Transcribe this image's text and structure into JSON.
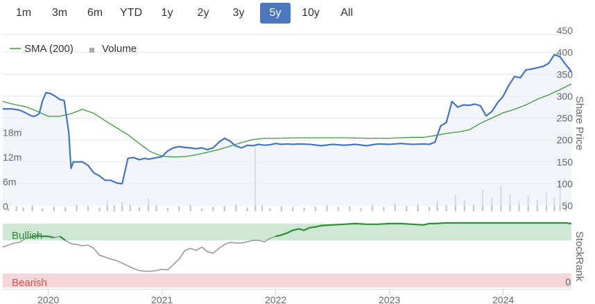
{
  "range_selector": {
    "buttons": [
      "1m",
      "3m",
      "6m",
      "YTD",
      "1y",
      "2y",
      "3y",
      "5y",
      "10y",
      "All"
    ],
    "active": "5y",
    "active_color": "#4a77be"
  },
  "colors": {
    "price": "#4472c4",
    "sma": "#3a9a3a",
    "volume": "#c8c8c8",
    "stockrank_bullish": "#2e8b3a",
    "stockrank_neutral": "#999999",
    "bullish_band": "#cfe8d3",
    "bearish_band": "#f6d6d8",
    "bullish_text": "#2e8b3a",
    "bearish_text": "#d9534f"
  },
  "chart_data": [
    {
      "type": "line",
      "legend": [
        "SMA (200)",
        "Volume"
      ],
      "ylabel": "Share Price",
      "ylim": [
        50,
        450
      ],
      "yticks": [
        450,
        400,
        350,
        300,
        250,
        200,
        150,
        100,
        50
      ],
      "volume_ylabel": "",
      "volume_ticks": [
        "18m",
        "12m",
        "6m",
        "0"
      ],
      "volume_ylim": [
        0,
        24
      ],
      "xticks": [
        {
          "label": "2020",
          "t": 2020.0
        },
        {
          "label": "2021",
          "t": 2021.0
        },
        {
          "label": "2022",
          "t": 2022.0
        },
        {
          "label": "2023",
          "t": 2023.0
        },
        {
          "label": "2024",
          "t": 2024.0
        }
      ],
      "xlim": [
        2019.6,
        2024.6
      ],
      "series": [
        {
          "name": "Share price",
          "x": [
            2019.6,
            2019.68,
            2019.75,
            2019.8,
            2019.85,
            2019.88,
            2019.92,
            2019.95,
            2019.98,
            2020.02,
            2020.06,
            2020.1,
            2020.14,
            2020.18,
            2020.2,
            2020.22,
            2020.25,
            2020.3,
            2020.35,
            2020.4,
            2020.45,
            2020.5,
            2020.55,
            2020.6,
            2020.65,
            2020.7,
            2020.75,
            2020.8,
            2020.85,
            2020.88,
            2020.92,
            2020.96,
            2021.0,
            2021.05,
            2021.1,
            2021.15,
            2021.2,
            2021.25,
            2021.3,
            2021.35,
            2021.4,
            2021.45,
            2021.5,
            2021.55,
            2021.6,
            2021.65,
            2021.7,
            2021.75,
            2021.8,
            2021.85,
            2021.9,
            2021.95,
            2022.0,
            2022.05,
            2022.1,
            2022.15,
            2022.2,
            2022.3,
            2022.4,
            2022.5,
            2022.6,
            2022.7,
            2022.8,
            2022.9,
            2023.0,
            2023.1,
            2023.2,
            2023.3,
            2023.35,
            2023.4,
            2023.45,
            2023.5,
            2023.55,
            2023.6,
            2023.65,
            2023.7,
            2023.75,
            2023.8,
            2023.85,
            2023.9,
            2023.95,
            2024.0,
            2024.05,
            2024.1,
            2024.15,
            2024.2,
            2024.25,
            2024.3,
            2024.35,
            2024.4,
            2024.45,
            2024.5,
            2024.55,
            2024.58,
            2024.6
          ],
          "y": [
            271,
            271,
            268,
            262,
            255,
            254,
            260,
            290,
            308,
            306,
            300,
            293,
            290,
            218,
            135,
            150,
            150,
            150,
            142,
            125,
            118,
            108,
            108,
            102,
            100,
            158,
            160,
            155,
            158,
            156,
            158,
            160,
            162,
            175,
            182,
            185,
            183,
            182,
            180,
            182,
            178,
            182,
            195,
            204,
            197,
            186,
            182,
            188,
            187,
            190,
            188,
            189,
            192,
            190,
            191,
            190,
            191,
            190,
            187,
            190,
            188,
            190,
            187,
            191,
            190,
            192,
            190,
            191,
            190,
            195,
            232,
            240,
            288,
            275,
            280,
            279,
            282,
            278,
            255,
            265,
            285,
            300,
            325,
            345,
            342,
            360,
            362,
            365,
            368,
            375,
            395,
            390,
            372,
            363,
            355
          ]
        },
        {
          "name": "SMA (200)",
          "x": [
            2019.6,
            2019.7,
            2019.8,
            2019.9,
            2020.0,
            2020.1,
            2020.2,
            2020.3,
            2020.4,
            2020.5,
            2020.6,
            2020.7,
            2020.8,
            2020.9,
            2021.0,
            2021.1,
            2021.2,
            2021.3,
            2021.4,
            2021.5,
            2021.6,
            2021.7,
            2021.8,
            2021.9,
            2022.0,
            2022.2,
            2022.4,
            2022.6,
            2022.8,
            2023.0,
            2023.2,
            2023.3,
            2023.4,
            2023.5,
            2023.6,
            2023.7,
            2023.8,
            2023.9,
            2024.0,
            2024.1,
            2024.2,
            2024.3,
            2024.4,
            2024.5,
            2024.6
          ],
          "y": [
            288,
            281,
            276,
            266,
            254,
            254,
            260,
            270,
            261,
            244,
            228,
            212,
            192,
            173,
            163,
            161,
            162,
            166,
            172,
            178,
            186,
            194,
            201,
            204,
            204,
            205,
            205,
            205,
            204,
            204,
            206,
            206,
            210,
            215,
            218,
            223,
            238,
            250,
            262,
            270,
            280,
            293,
            303,
            315,
            328
          ]
        }
      ],
      "volume": {
        "x": [
          2019.65,
          2019.72,
          2019.78,
          2019.86,
          2019.95,
          2020.05,
          2020.15,
          2020.25,
          2020.35,
          2020.45,
          2020.52,
          2020.58,
          2020.65,
          2020.72,
          2020.8,
          2020.88,
          2020.95,
          2021.05,
          2021.15,
          2021.25,
          2021.35,
          2021.45,
          2021.55,
          2021.65,
          2021.75,
          2021.82,
          2021.88,
          2021.95,
          2022.05,
          2022.15,
          2022.25,
          2022.35,
          2022.45,
          2022.55,
          2022.65,
          2022.75,
          2022.85,
          2022.95,
          2023.05,
          2023.15,
          2023.25,
          2023.35,
          2023.42,
          2023.5,
          2023.58,
          2023.66,
          2023.74,
          2023.82,
          2023.9,
          2023.98,
          2024.06,
          2024.14,
          2024.22,
          2024.3,
          2024.38,
          2024.45,
          2024.5,
          2024.55
        ],
        "values": [
          0.8,
          1.2,
          0.9,
          1.4,
          0.7,
          1.1,
          1.0,
          1.6,
          1.3,
          0.9,
          2.8,
          1.5,
          2.2,
          1.8,
          1.0,
          3.0,
          1.4,
          0.8,
          1.2,
          1.5,
          0.7,
          1.1,
          1.3,
          1.9,
          0.9,
          16.0,
          1.5,
          0.8,
          1.2,
          1.0,
          0.9,
          1.1,
          1.4,
          1.0,
          1.2,
          0.8,
          1.5,
          1.1,
          2.0,
          1.3,
          1.8,
          1.1,
          2.6,
          1.5,
          3.9,
          2.8,
          1.6,
          5.2,
          3.3,
          6.3,
          4.1,
          2.5,
          3.9,
          2.8,
          4.6,
          3.2,
          7.7,
          2.1
        ]
      }
    },
    {
      "type": "line",
      "ylabel": "StockRank",
      "ylim": [
        0,
        100
      ],
      "yticks": [
        0
      ],
      "band_labels": [
        "Bullish",
        "Bearish"
      ],
      "xlim": [
        2019.6,
        2024.6
      ],
      "series": [
        {
          "name": "StockRank",
          "x": [
            2019.6,
            2019.65,
            2019.7,
            2019.75,
            2019.8,
            2019.85,
            2019.9,
            2019.95,
            2020.0,
            2020.05,
            2020.1,
            2020.15,
            2020.2,
            2020.25,
            2020.3,
            2020.35,
            2020.4,
            2020.45,
            2020.5,
            2020.55,
            2020.6,
            2020.65,
            2020.7,
            2020.75,
            2020.8,
            2020.85,
            2020.9,
            2020.95,
            2021.0,
            2021.05,
            2021.1,
            2021.15,
            2021.2,
            2021.25,
            2021.3,
            2021.35,
            2021.4,
            2021.45,
            2021.5,
            2021.55,
            2021.6,
            2021.65,
            2021.7,
            2021.75,
            2021.8,
            2021.85,
            2021.9,
            2021.95,
            2022.0,
            2022.05,
            2022.1,
            2022.15,
            2022.2,
            2022.25,
            2022.3,
            2022.35,
            2022.4,
            2022.5,
            2022.6,
            2022.7,
            2022.8,
            2022.9,
            2023.0,
            2023.1,
            2023.2,
            2023.3,
            2023.35,
            2023.4,
            2023.5,
            2023.6,
            2023.7,
            2023.8,
            2023.9,
            2024.0,
            2024.1,
            2024.2,
            2024.3,
            2024.4,
            2024.5,
            2024.55,
            2024.6
          ],
          "y": [
            60,
            63,
            66,
            67,
            73,
            75,
            77,
            76,
            76,
            74,
            76,
            70,
            65,
            64,
            62,
            63,
            58,
            48,
            45,
            42,
            40,
            36,
            32,
            28,
            25,
            24,
            24,
            25,
            27,
            26,
            34,
            42,
            55,
            58,
            55,
            60,
            53,
            51,
            58,
            64,
            67,
            66,
            66,
            68,
            70,
            70,
            68,
            73,
            76,
            78,
            81,
            85,
            87,
            85,
            89,
            90,
            92,
            93,
            94,
            95,
            94,
            94,
            95,
            95,
            94,
            93,
            95,
            95,
            96,
            96,
            96,
            96,
            96,
            96,
            96,
            96,
            96,
            96,
            96,
            96,
            95
          ]
        }
      ]
    }
  ]
}
